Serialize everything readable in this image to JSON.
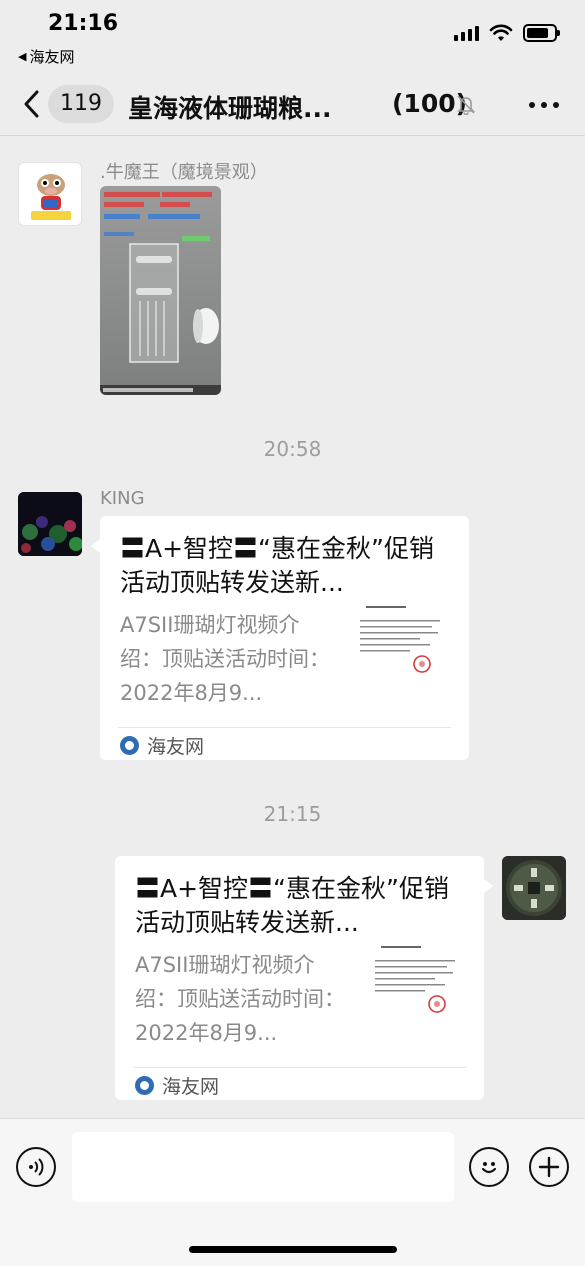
{
  "status": {
    "time": "21:16",
    "back_app": "海友网"
  },
  "nav": {
    "unread_count": "119",
    "title": "皇海液体珊瑚粮...",
    "member_count": "(100)"
  },
  "messages": {
    "msg1": {
      "sender": ".牛魔王（魔境景观）"
    },
    "time1": "20:58",
    "msg2": {
      "sender": "KING",
      "card_title": "〓A+智控〓“惠在金秋”促销活动顶贴转发送新...",
      "card_desc": "A7SII珊瑚灯视频介绍：顶贴送活动时间：2022年8月9...",
      "source": "海友网"
    },
    "time2": "21:15",
    "msg3": {
      "card_title": "〓A+智控〓“惠在金秋”促销活动顶贴转发送新...",
      "card_desc": "A7SII珊瑚灯视频介绍：顶贴送活动时间：2022年8月9...",
      "source": "海友网"
    }
  },
  "input": {
    "placeholder": ""
  }
}
